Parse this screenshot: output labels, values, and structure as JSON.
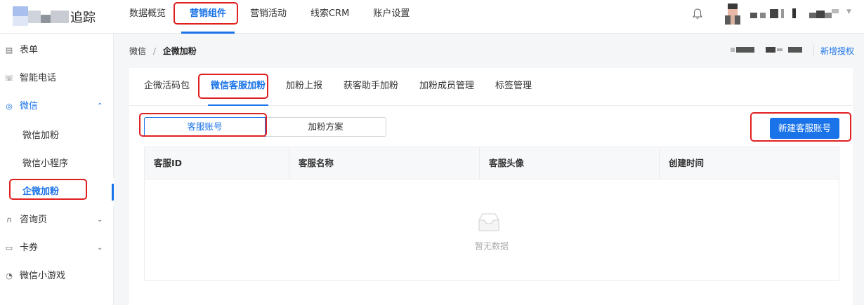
{
  "header": {
    "logo_text": "追踪",
    "nav": [
      {
        "label": "数据概览",
        "active": false
      },
      {
        "label": "营销组件",
        "active": true
      },
      {
        "label": "营销活动",
        "active": false
      },
      {
        "label": "线索CRM",
        "active": false
      },
      {
        "label": "账户设置",
        "active": false
      }
    ],
    "icons": {
      "bell": "bell-icon",
      "caret": "caret-down-icon"
    }
  },
  "sidebar": {
    "items": [
      {
        "label": "表单",
        "icon": "form-icon"
      },
      {
        "label": "智能电话",
        "icon": "phone-icon"
      },
      {
        "label": "微信",
        "icon": "wechat-icon",
        "expanded": true
      },
      {
        "label": "咨询页",
        "icon": "headset-icon"
      },
      {
        "label": "卡券",
        "icon": "card-icon"
      },
      {
        "label": "微信小游戏",
        "icon": "game-icon"
      }
    ],
    "sub_items": [
      {
        "label": "微信加粉",
        "active": false
      },
      {
        "label": "微信小程序",
        "active": false
      },
      {
        "label": "企微加粉",
        "active": true
      }
    ]
  },
  "breadcrumb": {
    "parent": "微信",
    "separator": "/",
    "current": "企微加粉"
  },
  "account": {
    "add_auth": "新增授权"
  },
  "tabs": [
    {
      "label": "企微活码包",
      "active": false
    },
    {
      "label": "微信客服加粉",
      "active": true
    },
    {
      "label": "加粉上报",
      "active": false
    },
    {
      "label": "获客助手加粉",
      "active": false
    },
    {
      "label": "加粉成员管理",
      "active": false
    },
    {
      "label": "标签管理",
      "active": false
    }
  ],
  "segment": {
    "options": [
      "客服账号",
      "加粉方案"
    ],
    "selected": "客服账号"
  },
  "new_button": "新建客服账号",
  "table": {
    "columns": [
      "客服ID",
      "客服名称",
      "客服头像",
      "创建时间"
    ],
    "rows": [],
    "empty_text": "暂无数据"
  },
  "colors": {
    "primary": "#1a73e8",
    "highlight": "#e02020"
  }
}
